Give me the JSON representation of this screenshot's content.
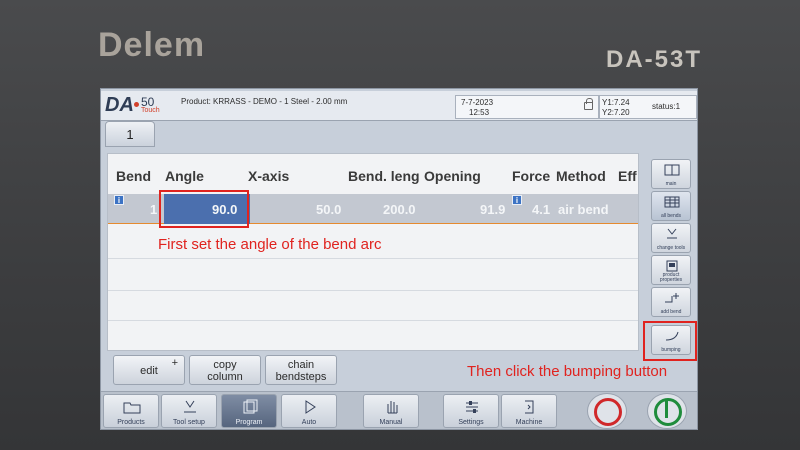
{
  "bezel": {
    "brand": "Delem",
    "model": "DA-53T"
  },
  "header": {
    "logo_da": "DA",
    "logo_num": "50",
    "logo_touch": "Touch",
    "product": "Product: KRRASS - DEMO - 1 Steel - 2.00 mm",
    "date": "7-7-2023",
    "time": "12:53",
    "y1": "Y1:7.24",
    "y2": "Y2:7.20",
    "status": "status:1"
  },
  "tab": {
    "label": "1"
  },
  "table": {
    "headers": [
      "Bend",
      "Angle",
      "X-axis",
      "Bend. leng",
      "Opening",
      "Force",
      "Method",
      "Eff"
    ],
    "rows": [
      {
        "bend": "1",
        "angle": "90.0",
        "x_axis": "50.0",
        "bend_length": "200.0",
        "opening": "91.9",
        "force": "4.1",
        "method": "air bend"
      }
    ],
    "info_badge": "i"
  },
  "side_buttons": [
    {
      "label": "main",
      "icon": "main-view-icon"
    },
    {
      "label": "all bends",
      "icon": "all-bends-icon"
    },
    {
      "label": "change tools",
      "icon": "change-tools-icon"
    },
    {
      "label": "product properties",
      "icon": "product-properties-icon"
    },
    {
      "label": "add bend",
      "icon": "add-bend-icon"
    },
    {
      "label": "bumping",
      "icon": "bumping-icon"
    }
  ],
  "actions": {
    "edit": "edit",
    "edit_plus": "+",
    "copy": "copy column",
    "chain": "chain bendsteps"
  },
  "nav": [
    {
      "label": "Products",
      "icon": "folder-icon"
    },
    {
      "label": "Tool setup",
      "icon": "tool-setup-icon"
    },
    {
      "label": "Program",
      "icon": "program-icon"
    },
    {
      "label": "Auto",
      "icon": "play-icon"
    },
    {
      "label": "Manual",
      "icon": "hand-icon"
    },
    {
      "label": "Settings",
      "icon": "settings-icon"
    },
    {
      "label": "Machine",
      "icon": "machine-icon"
    }
  ],
  "annotations": {
    "angle_note": "First set the angle of the bend arc",
    "bumping_note": "Then click the bumping button"
  },
  "colors": {
    "annotation": "#e0231f",
    "selected_cell": "#4b6fae",
    "stop": "#d0282a",
    "start": "#1f8c3c"
  }
}
